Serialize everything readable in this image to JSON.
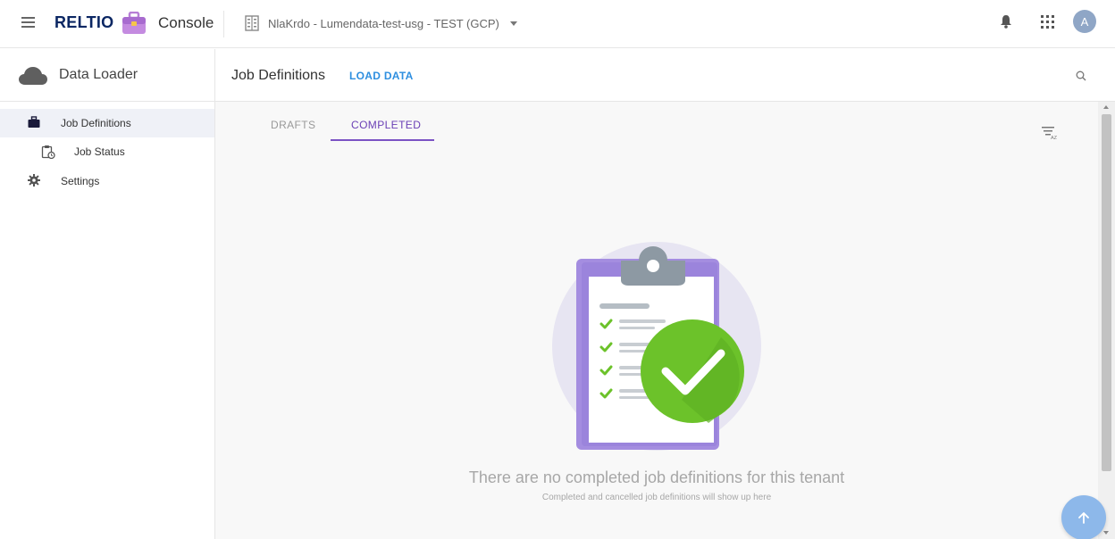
{
  "topbar": {
    "brand": "RELTIO",
    "product": "Console",
    "tenant": "NlaKrdo - Lumendata-test-usg - TEST (GCP)",
    "avatar_initial": "A",
    "icons": [
      "menu-icon",
      "toolbox-logo-icon",
      "building-icon",
      "chevron-down-icon",
      "bell-icon",
      "apps-grid-icon"
    ]
  },
  "sidebar": {
    "title": "Data Loader",
    "items": [
      {
        "label": "Job Definitions",
        "icon": "briefcase-icon",
        "active": true
      },
      {
        "label": "Job Status",
        "icon": "clipboard-clock-icon",
        "active": false
      },
      {
        "label": "Settings",
        "icon": "gear-icon",
        "active": false
      }
    ]
  },
  "main": {
    "title": "Job Definitions",
    "load_data": "LOAD DATA",
    "tabs": [
      {
        "label": "DRAFTS",
        "active": false
      },
      {
        "label": "COMPLETED",
        "active": true
      }
    ],
    "sort_badge": "AZ",
    "empty_title": "There are no completed job definitions for this tenant",
    "empty_subtitle": "Completed and cancelled job definitions will show up here"
  },
  "colors": {
    "brand_navy": "#0b2763",
    "accent_purple": "#7b52c4",
    "link_blue": "#2e8fe0",
    "success_green": "#6cc22a",
    "fab_blue": "#8db8ea"
  }
}
